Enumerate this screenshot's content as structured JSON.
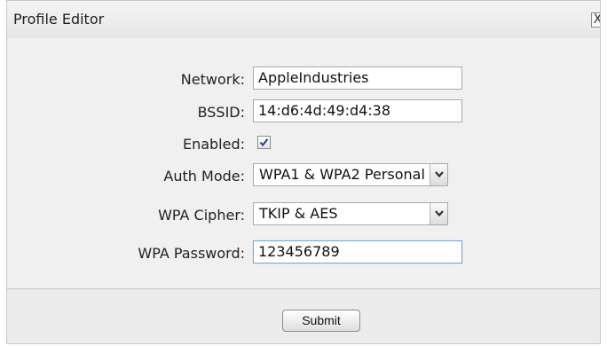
{
  "dialog": {
    "title": "Profile Editor",
    "close_label": "X"
  },
  "form": {
    "network": {
      "label": "Network:",
      "value": "AppleIndustries"
    },
    "bssid": {
      "label": "BSSID:",
      "value": "14:d6:4d:49:d4:38"
    },
    "enabled": {
      "label": "Enabled:",
      "checked": true
    },
    "auth_mode": {
      "label": "Auth Mode:",
      "value": "WPA1 & WPA2 Personal"
    },
    "wpa_cipher": {
      "label": "WPA Cipher:",
      "value": "TKIP & AES"
    },
    "wpa_password": {
      "label": "WPA Password:",
      "value": "123456789"
    }
  },
  "footer": {
    "submit_label": "Submit"
  },
  "icons": {
    "check": "check-icon",
    "dropdown": "chevron-down-icon",
    "close": "close-icon"
  }
}
